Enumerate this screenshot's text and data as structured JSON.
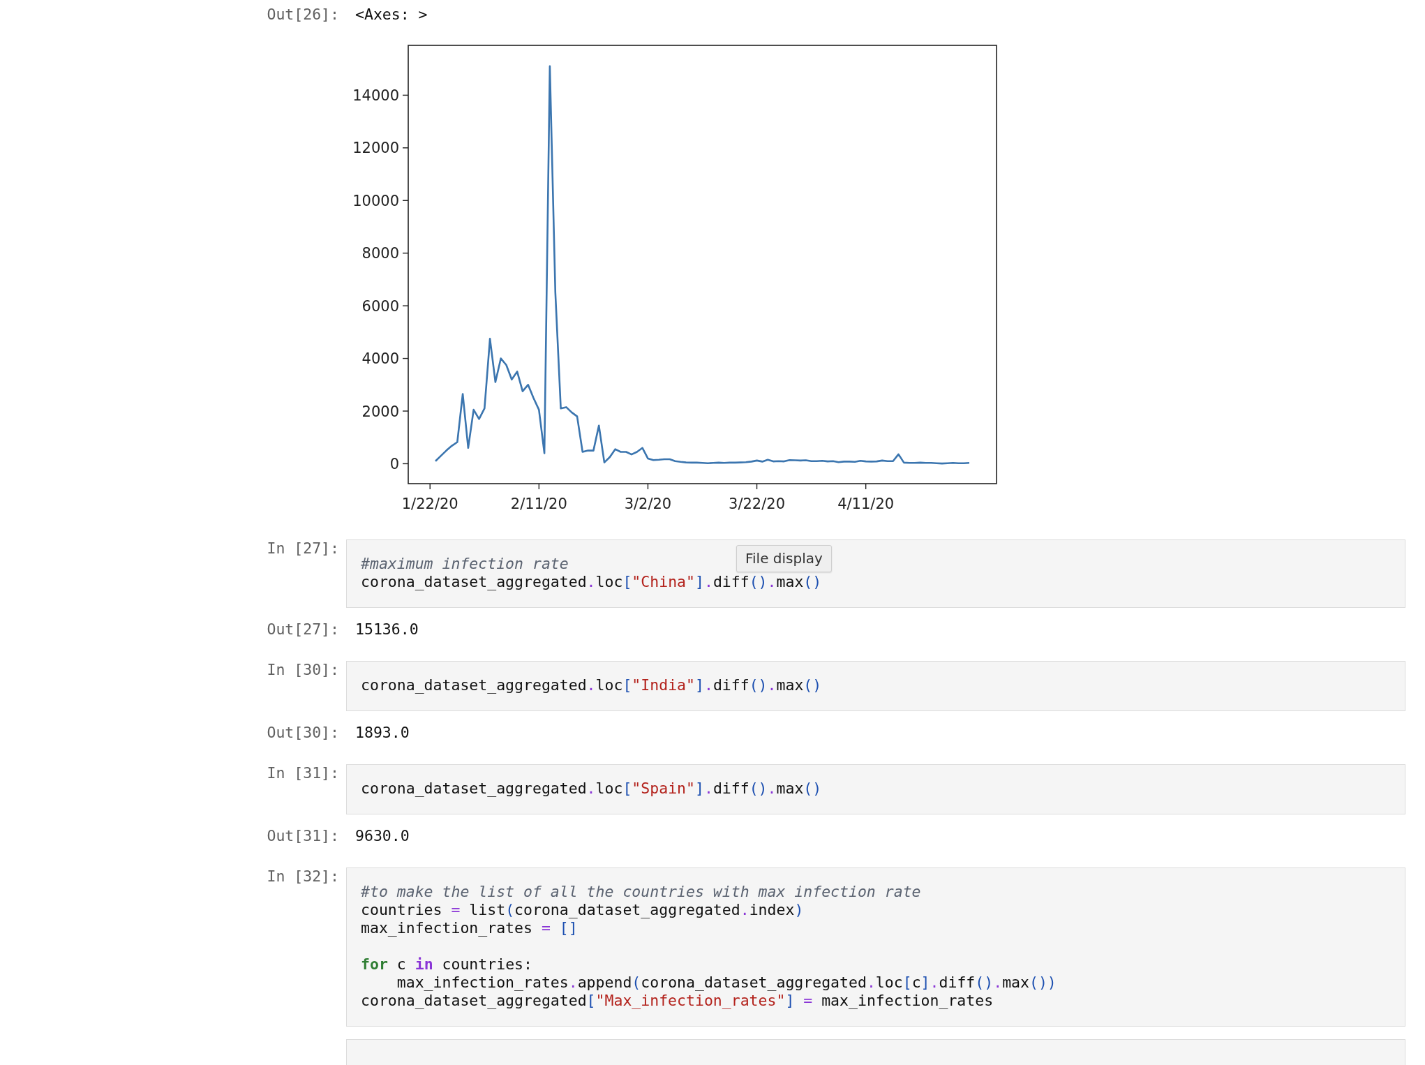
{
  "cells": [
    {
      "kind": "output",
      "prompt": "Out[26]:",
      "text": "<Axes: >"
    },
    {
      "kind": "plot",
      "chart_data": {
        "type": "line",
        "categories": [
          "1/22/20",
          null,
          null,
          null,
          null,
          null,
          null,
          null,
          null,
          null,
          null,
          null,
          null,
          null,
          null,
          null,
          null,
          null,
          null,
          null,
          "2/11/20",
          null,
          null,
          null,
          null,
          null,
          null,
          null,
          null,
          null,
          null,
          null,
          null,
          null,
          null,
          null,
          null,
          null,
          null,
          null,
          "3/2/20",
          null,
          null,
          null,
          null,
          null,
          null,
          null,
          null,
          null,
          null,
          null,
          null,
          null,
          null,
          null,
          null,
          null,
          null,
          null,
          "3/22/20",
          null,
          null,
          null,
          null,
          null,
          null,
          null,
          null,
          null,
          null,
          null,
          null,
          null,
          null,
          null,
          null,
          null,
          null,
          null,
          "4/11/20",
          null,
          null,
          null,
          null,
          null,
          null,
          null,
          null,
          null,
          null,
          null,
          null,
          null,
          null,
          null,
          null,
          null,
          null,
          null
        ],
        "series": [
          {
            "color": "#3b75af",
            "values": [
              null,
              100,
              300,
              500,
              680,
              820,
              2650,
              600,
              2050,
              1700,
              2100,
              4750,
              3100,
              4000,
              3750,
              3200,
              3500,
              2750,
              3000,
              2500,
              2050,
              400,
              15100,
              6500,
              2100,
              2150,
              1950,
              1800,
              450,
              500,
              500,
              1450,
              50,
              250,
              550,
              450,
              450,
              350,
              450,
              600,
              200,
              140,
              150,
              170,
              170,
              100,
              70,
              50,
              40,
              40,
              30,
              20,
              30,
              40,
              30,
              40,
              40,
              50,
              60,
              80,
              120,
              80,
              150,
              90,
              100,
              90,
              140,
              130,
              120,
              130,
              100,
              100,
              110,
              90,
              100,
              60,
              80,
              80,
              70,
              110,
              90,
              80,
              90,
              120,
              100,
              100,
              360,
              40,
              30,
              30,
              40,
              30,
              30,
              20,
              10,
              20,
              30,
              20,
              20,
              30
            ]
          }
        ],
        "ylim": [
          -757,
          15893
        ],
        "yticks": [
          0,
          2000,
          4000,
          6000,
          8000,
          10000,
          12000,
          14000
        ]
      }
    },
    {
      "kind": "input",
      "prompt": "In [27]:",
      "lines": [
        {
          "tokens": [
            {
              "kind": "comment",
              "text": "#maximum infection rate"
            }
          ]
        },
        {
          "tokens": [
            {
              "kind": "name",
              "text": "corona_dataset_aggregated"
            },
            {
              "kind": "op",
              "text": "."
            },
            {
              "kind": "name",
              "text": "loc"
            },
            {
              "kind": "punct",
              "text": "["
            },
            {
              "kind": "string",
              "text": "\"China\""
            },
            {
              "kind": "punct",
              "text": "]"
            },
            {
              "kind": "op",
              "text": "."
            },
            {
              "kind": "name",
              "text": "diff"
            },
            {
              "kind": "punct",
              "text": "()"
            },
            {
              "kind": "op",
              "text": "."
            },
            {
              "kind": "name",
              "text": "max"
            },
            {
              "kind": "punct",
              "text": "()"
            }
          ]
        }
      ]
    },
    {
      "kind": "output",
      "prompt": "Out[27]:",
      "text": "15136.0"
    },
    {
      "kind": "input",
      "prompt": "In [30]:",
      "lines": [
        {
          "tokens": [
            {
              "kind": "name",
              "text": "corona_dataset_aggregated"
            },
            {
              "kind": "op",
              "text": "."
            },
            {
              "kind": "name",
              "text": "loc"
            },
            {
              "kind": "punct",
              "text": "["
            },
            {
              "kind": "string",
              "text": "\"India\""
            },
            {
              "kind": "punct",
              "text": "]"
            },
            {
              "kind": "op",
              "text": "."
            },
            {
              "kind": "name",
              "text": "diff"
            },
            {
              "kind": "punct",
              "text": "()"
            },
            {
              "kind": "op",
              "text": "."
            },
            {
              "kind": "name",
              "text": "max"
            },
            {
              "kind": "punct",
              "text": "()"
            }
          ]
        }
      ]
    },
    {
      "kind": "output",
      "prompt": "Out[30]:",
      "text": "1893.0"
    },
    {
      "kind": "input",
      "prompt": "In [31]:",
      "lines": [
        {
          "tokens": [
            {
              "kind": "name",
              "text": "corona_dataset_aggregated"
            },
            {
              "kind": "op",
              "text": "."
            },
            {
              "kind": "name",
              "text": "loc"
            },
            {
              "kind": "punct",
              "text": "["
            },
            {
              "kind": "string",
              "text": "\"Spain\""
            },
            {
              "kind": "punct",
              "text": "]"
            },
            {
              "kind": "op",
              "text": "."
            },
            {
              "kind": "name",
              "text": "diff"
            },
            {
              "kind": "punct",
              "text": "()"
            },
            {
              "kind": "op",
              "text": "."
            },
            {
              "kind": "name",
              "text": "max"
            },
            {
              "kind": "punct",
              "text": "()"
            }
          ]
        }
      ]
    },
    {
      "kind": "output",
      "prompt": "Out[31]:",
      "text": "9630.0"
    },
    {
      "kind": "input",
      "prompt": "In [32]:",
      "lines": [
        {
          "tokens": [
            {
              "kind": "comment",
              "text": "#to make the list of all the countries with max infection rate"
            }
          ]
        },
        {
          "tokens": [
            {
              "kind": "name",
              "text": "countries "
            },
            {
              "kind": "op",
              "text": "="
            },
            {
              "kind": "name",
              "text": " list"
            },
            {
              "kind": "punct",
              "text": "("
            },
            {
              "kind": "name",
              "text": "corona_dataset_aggregated"
            },
            {
              "kind": "op",
              "text": "."
            },
            {
              "kind": "name",
              "text": "index"
            },
            {
              "kind": "punct",
              "text": ")"
            }
          ]
        },
        {
          "tokens": [
            {
              "kind": "name",
              "text": "max_infection_rates "
            },
            {
              "kind": "op",
              "text": "="
            },
            {
              "kind": "punct",
              "text": " []"
            }
          ]
        },
        {
          "gap_before": true,
          "tokens": [
            {
              "kind": "keyword",
              "text": "for"
            },
            {
              "kind": "name",
              "text": " c "
            },
            {
              "kind": "opword",
              "text": "in"
            },
            {
              "kind": "name",
              "text": " countries:"
            }
          ]
        },
        {
          "tokens": [
            {
              "kind": "name",
              "text": "    max_infection_rates"
            },
            {
              "kind": "op",
              "text": "."
            },
            {
              "kind": "name",
              "text": "append"
            },
            {
              "kind": "punct",
              "text": "("
            },
            {
              "kind": "name",
              "text": "corona_dataset_aggregated"
            },
            {
              "kind": "op",
              "text": "."
            },
            {
              "kind": "name",
              "text": "loc"
            },
            {
              "kind": "punct",
              "text": "["
            },
            {
              "kind": "name",
              "text": "c"
            },
            {
              "kind": "punct",
              "text": "]"
            },
            {
              "kind": "op",
              "text": "."
            },
            {
              "kind": "name",
              "text": "diff"
            },
            {
              "kind": "punct",
              "text": "()"
            },
            {
              "kind": "op",
              "text": "."
            },
            {
              "kind": "name",
              "text": "max"
            },
            {
              "kind": "punct",
              "text": "())"
            }
          ]
        },
        {
          "tokens": [
            {
              "kind": "name",
              "text": "corona_dataset_aggregated"
            },
            {
              "kind": "punct",
              "text": "["
            },
            {
              "kind": "string",
              "text": "\"Max_infection_rates\""
            },
            {
              "kind": "punct",
              "text": "] "
            },
            {
              "kind": "op",
              "text": "="
            },
            {
              "kind": "name",
              "text": " max_infection_rates"
            }
          ]
        }
      ]
    },
    {
      "kind": "input_partial"
    }
  ],
  "tooltip": {
    "text": "File display"
  }
}
